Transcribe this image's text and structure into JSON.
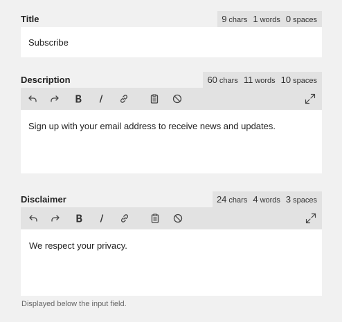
{
  "title_field": {
    "label": "Title",
    "counter": {
      "chars": "9",
      "chars_unit": "chars",
      "words": "1",
      "words_unit": "words",
      "spaces": "0",
      "spaces_unit": "spaces"
    },
    "value": "Subscribe"
  },
  "description_field": {
    "label": "Description",
    "counter": {
      "chars": "60",
      "chars_unit": "chars",
      "words": "11",
      "words_unit": "words",
      "spaces": "10",
      "spaces_unit": "spaces"
    },
    "toolbar": [
      "undo-icon",
      "redo-icon",
      "bold-icon",
      "italic-icon",
      "link-icon",
      "clipboard-icon",
      "clear-format-icon",
      "expand-icon"
    ],
    "value": "Sign up with your email address to receive news and updates."
  },
  "disclaimer_field": {
    "label": "Disclaimer",
    "counter": {
      "chars": "24",
      "chars_unit": "chars",
      "words": "4",
      "words_unit": "words",
      "spaces": "3",
      "spaces_unit": "spaces"
    },
    "toolbar": [
      "undo-icon",
      "redo-icon",
      "bold-icon",
      "italic-icon",
      "link-icon",
      "clipboard-icon",
      "clear-format-icon",
      "expand-icon"
    ],
    "value": "We respect your privacy.",
    "hint": "Displayed below the input field."
  }
}
